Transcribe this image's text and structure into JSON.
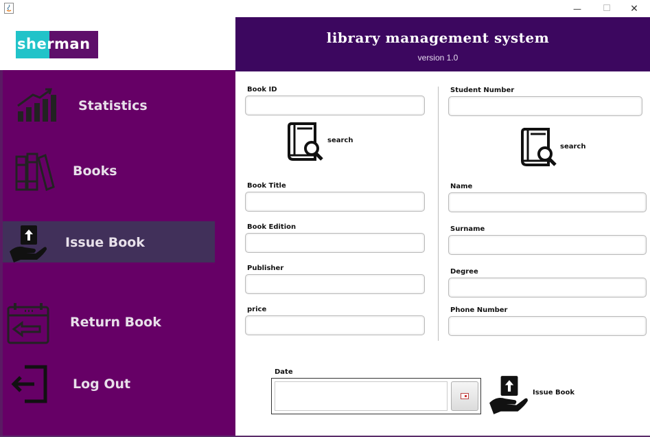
{
  "window": {
    "minimize_glyph": "—",
    "maximize_glyph": "☐",
    "close_glyph": "✕",
    "app_icon": "java-icon"
  },
  "brand": {
    "logo_text": "sherman",
    "logo_colors": [
      "#21c3c9",
      "#5e0f6a"
    ]
  },
  "header": {
    "title": "library management system",
    "version": "version 1.0"
  },
  "sidebar": {
    "items": [
      {
        "label": "Statistics",
        "icon": "bar-chart-icon"
      },
      {
        "label": "Books",
        "icon": "books-icon"
      },
      {
        "label": "Issue Book",
        "icon": "issue-book-icon",
        "active": true
      },
      {
        "label": "Return Book",
        "icon": "calendar-return-icon"
      },
      {
        "label": "Log Out",
        "icon": "logout-icon"
      }
    ]
  },
  "book": {
    "book_id_label": "Book ID",
    "search_label": "search",
    "title_label": "Book Title",
    "edition_label": "Book Edition",
    "publisher_label": "Publisher",
    "price_label": "price"
  },
  "student": {
    "number_label": "Student Number",
    "search_label": "search",
    "name_label": "Name",
    "surname_label": "Surname",
    "degree_label": "Degree",
    "phone_label": "Phone Number"
  },
  "issue": {
    "date_label": "Date",
    "button_label": "Issue Book"
  },
  "colors": {
    "sidebar": "#660066",
    "header": "#3c075f",
    "active_item": "#41305a"
  }
}
